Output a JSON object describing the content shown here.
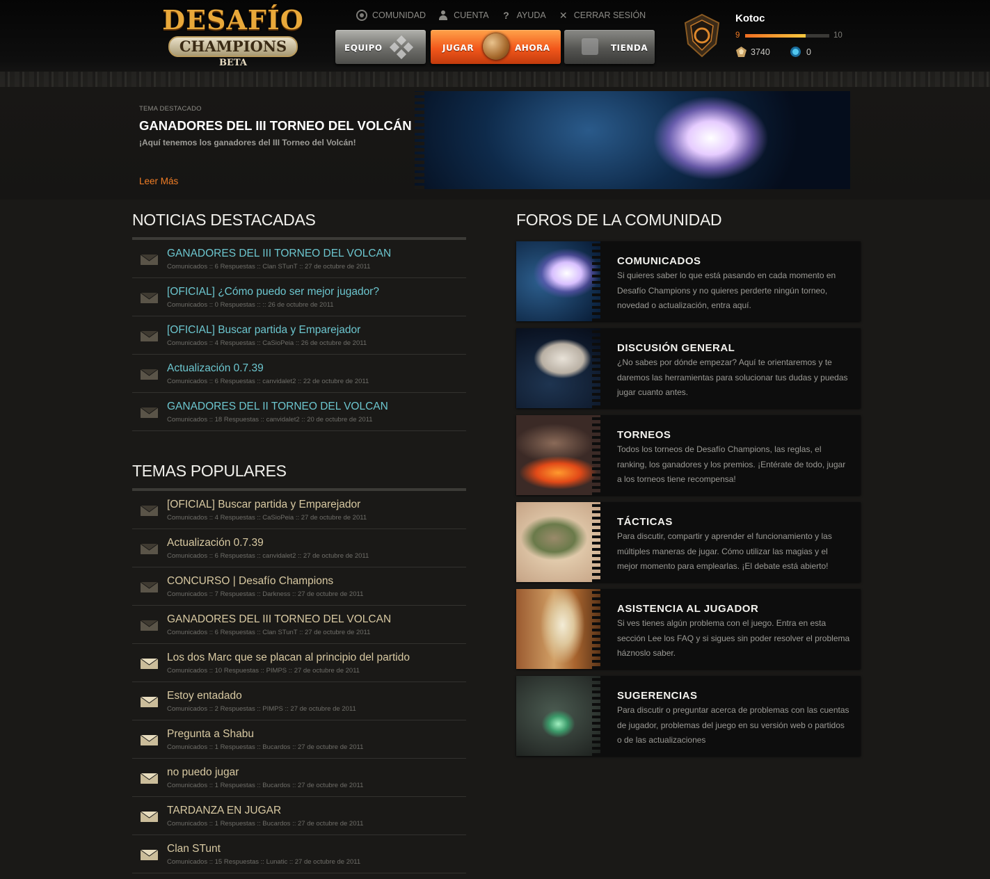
{
  "header": {
    "logo": {
      "line1": "DESAFÍO",
      "line2": "CHAMPIONS",
      "line3": "BETA"
    },
    "nav": [
      {
        "label": "COMUNIDAD",
        "icon": "community-icon"
      },
      {
        "label": "CUENTA",
        "icon": "user-icon"
      },
      {
        "label": "AYUDA",
        "icon": "question-icon"
      },
      {
        "label": "CERRAR SESIÓN",
        "icon": "close-icon"
      }
    ],
    "buttons": {
      "equipo": "EQUIPO",
      "jugar": "JUGAR",
      "ahora": "AHORA",
      "tienda": "TIENDA"
    },
    "player": {
      "name": "Kotoc",
      "level": "9",
      "next_level": "10",
      "level_progress": 0.72,
      "gold": "3740",
      "gems": "0"
    }
  },
  "featured": {
    "kicker": "TEMA DESTACADO",
    "title": "GANADORES DEL III TORNEO DEL VOLCÁN",
    "subtitle": "¡Aquí tenemos los ganadores del III Torneo del Volcán!",
    "read_more": "Leer Más"
  },
  "news": {
    "title": "NOTICIAS DESTACADAS",
    "items": [
      {
        "title": "GANADORES DEL III TORNEO DEL VOLCAN",
        "meta": "Comunicados :: 6 Respuestas :: Clan STunT :: 27 de octubre de 2011"
      },
      {
        "title": "[OFICIAL] ¿Cómo puedo ser mejor jugador?",
        "meta": "Comunicados :: 0 Respuestas :: :: 26 de octubre de 2011"
      },
      {
        "title": "[OFICIAL] Buscar partida y Emparejador",
        "meta": "Comunicados :: 4 Respuestas :: CaSioPeia :: 26 de octubre de 2011"
      },
      {
        "title": "Actualización 0.7.39",
        "meta": "Comunicados :: 6 Respuestas :: canvidalet2 :: 22 de octubre de 2011"
      },
      {
        "title": "GANADORES DEL II TORNEO DEL VOLCAN",
        "meta": "Comunicados :: 18 Respuestas :: canvidalet2 :: 20 de octubre de 2011"
      }
    ]
  },
  "popular": {
    "title": "TEMAS POPULARES",
    "items": [
      {
        "title": "[OFICIAL] Buscar partida y Emparejador",
        "meta": "Comunicados :: 4 Respuestas :: CaSioPeia :: 27 de octubre de 2011",
        "read": true
      },
      {
        "title": "Actualización 0.7.39",
        "meta": "Comunicados :: 6 Respuestas :: canvidalet2 :: 27 de octubre de 2011",
        "read": true
      },
      {
        "title": "CONCURSO | Desafío Champions",
        "meta": "Comunicados :: 7 Respuestas :: Darkness :: 27 de octubre de 2011",
        "read": true
      },
      {
        "title": "GANADORES DEL III TORNEO DEL VOLCAN",
        "meta": "Comunicados :: 6 Respuestas :: Clan STunT :: 27 de octubre de 2011",
        "read": true
      },
      {
        "title": "Los dos Marc que se placan al principio del partido",
        "meta": "Comunicados :: 10 Respuestas :: PIMPS :: 27 de octubre de 2011",
        "read": false
      },
      {
        "title": "Estoy entadado",
        "meta": "Comunicados :: 2 Respuestas :: PIMPS :: 27 de octubre de 2011",
        "read": false
      },
      {
        "title": "Pregunta a Shabu",
        "meta": "Comunicados :: 1 Respuestas :: Bucardos :: 27 de octubre de 2011",
        "read": false
      },
      {
        "title": "no puedo jugar",
        "meta": "Comunicados :: 1 Respuestas :: Bucardos :: 27 de octubre de 2011",
        "read": false
      },
      {
        "title": "TARDANZA EN JUGAR",
        "meta": "Comunicados :: 1 Respuestas :: Bucardos :: 27 de octubre de 2011",
        "read": false
      },
      {
        "title": "Clan STunt",
        "meta": "Comunicados :: 15 Respuestas :: Lunatic :: 27 de octubre de 2011",
        "read": false
      }
    ]
  },
  "forums": {
    "title": "FOROS DE LA COMUNIDAD",
    "items": [
      {
        "title": "COMUNICADOS",
        "desc": "Si quieres saber lo que está pasando en cada momento en Desafío Champions y no quieres perderte ningún torneo, novedad o actualización, entra aquí.",
        "theme": "space"
      },
      {
        "title": "DISCUSIÓN GENERAL",
        "desc": "¿No sabes por dónde empezar? Aquí te orientaremos y te daremos las herramientas para solucionar tus dudas y puedas jugar cuanto antes.",
        "theme": "asteroid"
      },
      {
        "title": "TORNEOS",
        "desc": "Todos los torneos de Desafío Champions, las reglas, el ranking, los ganadores y los premios. ¡Entérate de todo, jugar a los torneos tiene recompensa!",
        "theme": "volcano"
      },
      {
        "title": "TÁCTICAS",
        "desc": "Para discutir, compartir y aprender el funcionamiento y las múltiples maneras de jugar. Cómo utilizar las magias y el mejor momento para emplearlas. ¡El debate está abierto!",
        "theme": "forest-island"
      },
      {
        "title": "ASISTENCIA AL JUGADOR",
        "desc": "Si ves tienes algún problema con el juego. Entra en esta sección Lee los FAQ y si sigues sin poder resolver el problema háznoslo saber.",
        "theme": "canyon"
      },
      {
        "title": "SUGERENCIAS",
        "desc": "Para discutir o preguntar acerca de problemas con las cuentas de jugador, problemas del juego en su versión web o partidos o de las actualizaciones",
        "theme": "crystal-cave"
      }
    ]
  }
}
